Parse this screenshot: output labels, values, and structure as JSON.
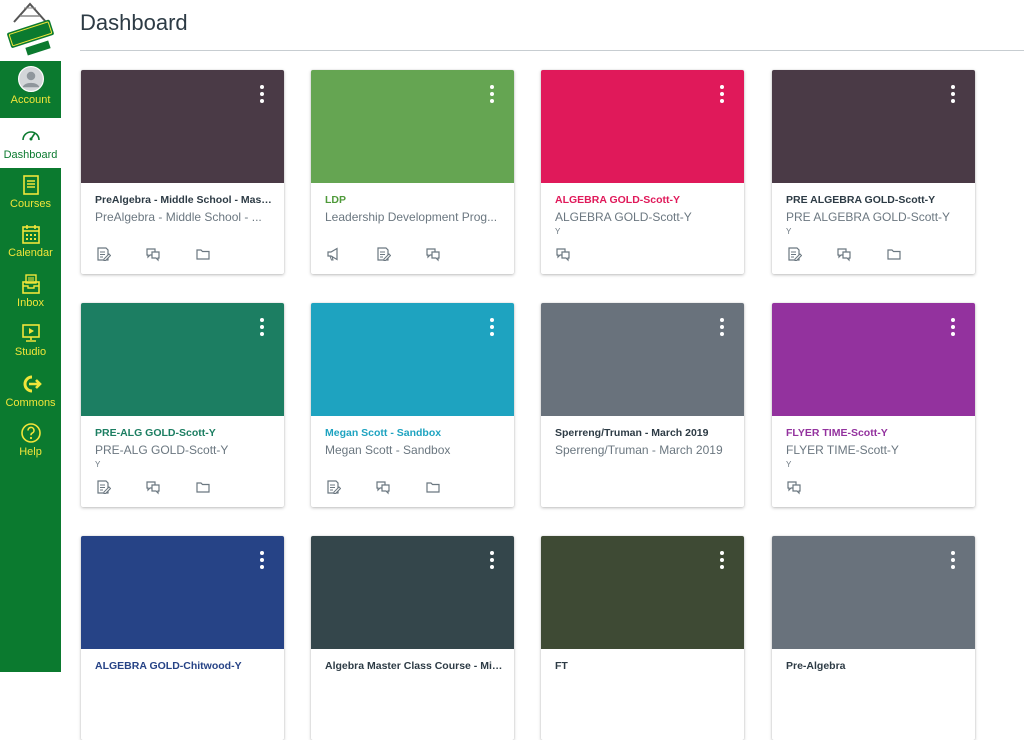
{
  "page": {
    "title": "Dashboard"
  },
  "colors": {
    "sidebar_bg": "#0b7a2f",
    "nav_text": "#f1e53a",
    "card_text_default": "#2d3b45"
  },
  "sidebar": {
    "items": [
      {
        "id": "account",
        "label": "Account",
        "icon": "avatar-icon"
      },
      {
        "id": "dashboard",
        "label": "Dashboard",
        "icon": "speedometer-icon",
        "active": true
      },
      {
        "id": "courses",
        "label": "Courses",
        "icon": "book-icon"
      },
      {
        "id": "calendar",
        "label": "Calendar",
        "icon": "calendar-icon"
      },
      {
        "id": "inbox",
        "label": "Inbox",
        "icon": "inbox-icon"
      },
      {
        "id": "studio",
        "label": "Studio",
        "icon": "studio-icon"
      },
      {
        "id": "commons",
        "label": "Commons",
        "icon": "commons-icon"
      },
      {
        "id": "help",
        "label": "Help",
        "icon": "help-icon"
      }
    ]
  },
  "cards": [
    {
      "title": "PreAlgebra - Middle School - Mast...",
      "subtitle": "PreAlgebra - Middle School - ...",
      "term": "",
      "color": "#4a3a46",
      "title_color": "#2d3b45",
      "actions": [
        "assignments-icon",
        "discussions-icon",
        "files-icon"
      ]
    },
    {
      "title": "LDP",
      "subtitle": "Leadership Development Prog...",
      "term": "",
      "color": "#65a552",
      "title_color": "#4f9a3a",
      "actions": [
        "announcements-icon",
        "assignments-icon",
        "discussions-icon"
      ]
    },
    {
      "title": "ALGEBRA GOLD-Scott-Y",
      "subtitle": "ALGEBRA GOLD-Scott-Y",
      "term": "Y",
      "color": "#e0195a",
      "title_color": "#e0195a",
      "actions": [
        "discussions-icon"
      ]
    },
    {
      "title": "PRE ALGEBRA GOLD-Scott-Y",
      "subtitle": "PRE ALGEBRA GOLD-Scott-Y",
      "term": "Y",
      "color": "#4a3a46",
      "title_color": "#2d3b45",
      "actions": [
        "assignments-icon",
        "discussions-icon",
        "files-icon"
      ]
    },
    {
      "title": "PRE-ALG GOLD-Scott-Y",
      "subtitle": "PRE-ALG GOLD-Scott-Y",
      "term": "Y",
      "color": "#1c7e62",
      "title_color": "#1c7e62",
      "actions": [
        "assignments-icon",
        "discussions-icon",
        "files-icon"
      ]
    },
    {
      "title": "Megan Scott - Sandbox",
      "subtitle": "Megan Scott - Sandbox",
      "term": "",
      "color": "#1ea3c0",
      "title_color": "#1ea3c0",
      "actions": [
        "assignments-icon",
        "discussions-icon",
        "files-icon"
      ]
    },
    {
      "title": "Sperreng/Truman - March 2019",
      "subtitle": "Sperreng/Truman - March 2019",
      "term": "",
      "color": "#69727c",
      "title_color": "#2d3b45",
      "actions": []
    },
    {
      "title": "FLYER TIME-Scott-Y",
      "subtitle": "FLYER TIME-Scott-Y",
      "term": "Y",
      "color": "#93329e",
      "title_color": "#93329e",
      "actions": [
        "discussions-icon"
      ]
    },
    {
      "title": "ALGEBRA GOLD-Chitwood-Y",
      "subtitle": "",
      "term": "",
      "color": "#264386",
      "title_color": "#264386",
      "actions": []
    },
    {
      "title": "Algebra Master Class Course - Mid...",
      "subtitle": "",
      "term": "",
      "color": "#34464b",
      "title_color": "#2d3b45",
      "actions": []
    },
    {
      "title": "FT",
      "subtitle": "",
      "term": "",
      "color": "#3e4a34",
      "title_color": "#2d3b45",
      "actions": []
    },
    {
      "title": "Pre-Algebra",
      "subtitle": "",
      "term": "",
      "color": "#69727c",
      "title_color": "#2d3b45",
      "actions": []
    }
  ]
}
